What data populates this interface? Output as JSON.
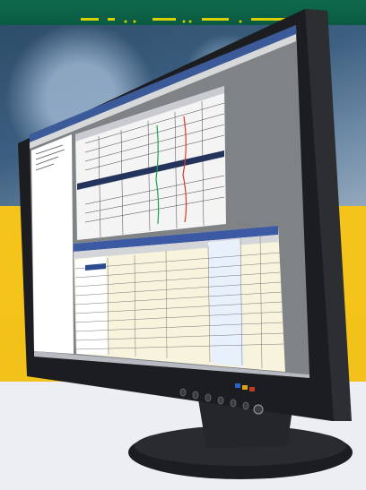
{
  "banner": {
    "color": "#0e6a4e"
  },
  "scene": {
    "description_colors": {
      "bezel": "#1a1c1f",
      "stand": "#222325",
      "yellow": "#f2c21a",
      "photo_bg": "#3d5f80"
    },
    "icons": [
      "monitor-icon",
      "power-button-icon",
      "menu-button-icon"
    ]
  }
}
